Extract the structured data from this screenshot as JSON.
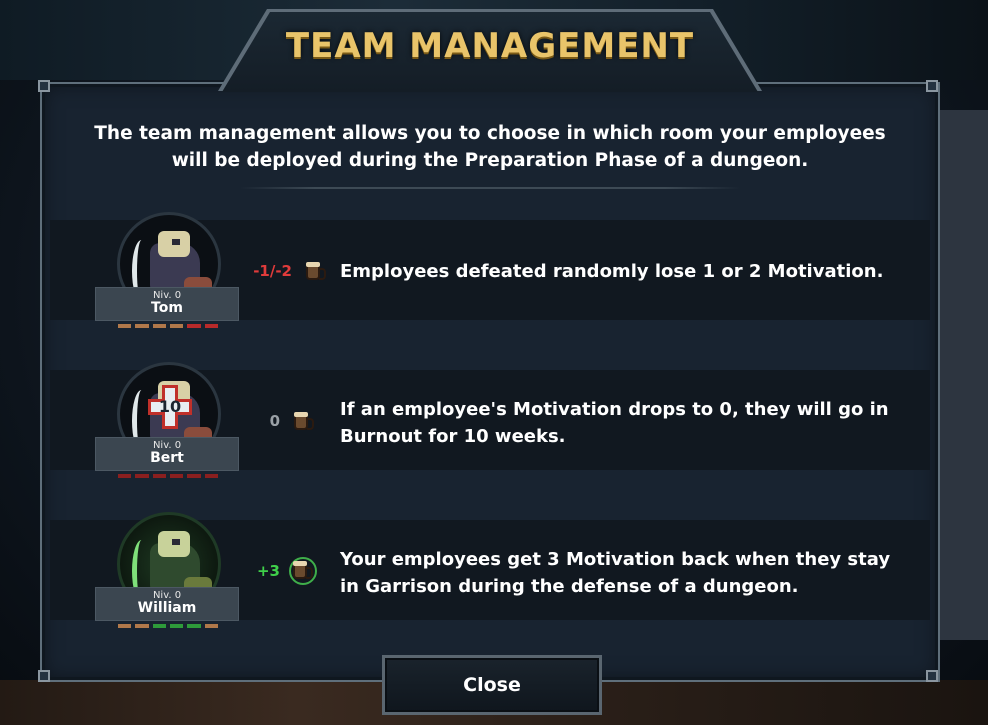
{
  "title": "TEAM MANAGEMENT",
  "intro": "The team management allows you to choose in which room your employees will be deployed during the Preparation Phase of a dungeon.",
  "rows": [
    {
      "employee_level": "Niv. 0",
      "employee_name": "Tom",
      "delta": "-1/-2",
      "delta_color": "#e03b3b",
      "description": "Employees defeated randomly lose 1 or 2 Motivation.",
      "pips": [
        "#b0784a",
        "#b0784a",
        "#b0784a",
        "#b0784a",
        "#b82a2a",
        "#b82a2a"
      ]
    },
    {
      "employee_level": "Niv. 0",
      "employee_name": "Bert",
      "burnout_badge": "10",
      "delta": "0",
      "delta_color": "#9aa0a6",
      "description": "If an employee's Motivation drops to 0, they will go in Burnout for 10 weeks.",
      "pips": [
        "#8a1f1f",
        "#8a1f1f",
        "#8a1f1f",
        "#8a1f1f",
        "#8a1f1f",
        "#8a1f1f"
      ]
    },
    {
      "employee_level": "Niv. 0",
      "employee_name": "William",
      "delta": "+3",
      "delta_color": "#3fd04a",
      "description": "Your employees get 3 Motivation back when they stay in Garrison during the defense of a dungeon.",
      "pips": [
        "#b0784a",
        "#b0784a",
        "#2e9a3a",
        "#2e9a3a",
        "#2e9a3a",
        "#b0784a"
      ]
    }
  ],
  "close_label": "Close",
  "icons": {
    "motivation": "beer-mug-icon",
    "blade": "blade-icon",
    "burnout": "medical-cross-icon"
  },
  "colors": {
    "title_gold": "#e9c46a",
    "panel_bg": "#182330",
    "row_bg": "#111820"
  }
}
